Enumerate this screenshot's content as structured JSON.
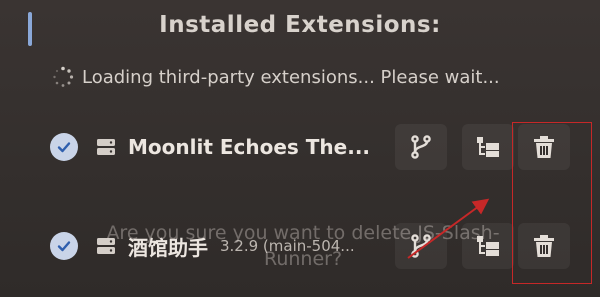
{
  "header": {
    "title": "Installed Extensions:"
  },
  "status": {
    "loading_text": "Loading third-party extensions... Please wait..."
  },
  "extensions": [
    {
      "name": "Moonlit Echoes The...",
      "version": "",
      "enabled": true
    },
    {
      "name": "酒馆助手",
      "version": "3.2.9 (main-504...",
      "enabled": true
    }
  ],
  "dialog": {
    "text": "Are you sure you want to delete JS-Slash-Runner?"
  },
  "icons": {
    "check": "check-icon",
    "server": "server-icon",
    "branch": "git-branch-icon",
    "tree": "tree-structure-icon",
    "delete": "trash-icon"
  },
  "colors": {
    "background": "#35302e",
    "check_badge": "#c9d4e8",
    "annotation_red": "#c62828",
    "accent_bar": "#8aa8d8"
  }
}
